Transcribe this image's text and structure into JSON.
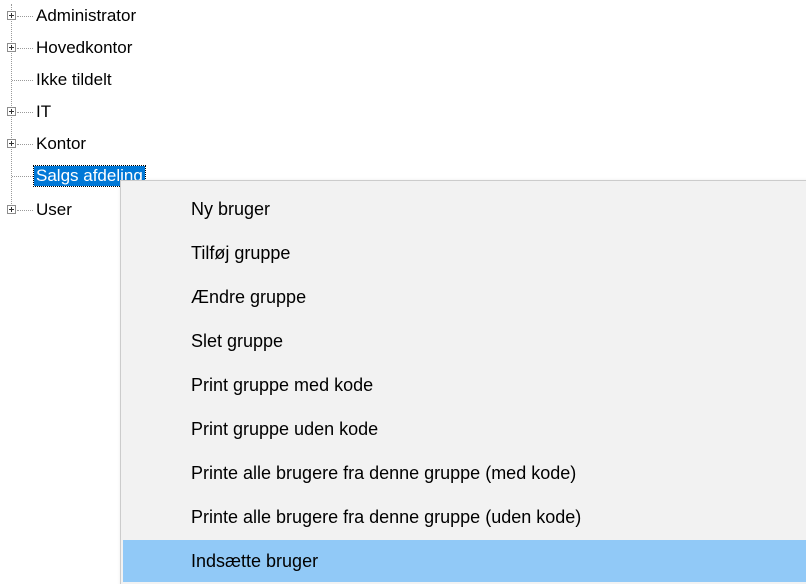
{
  "tree": {
    "items": [
      {
        "label": "Administrator",
        "expandable": true,
        "selected": false
      },
      {
        "label": "Hovedkontor",
        "expandable": true,
        "selected": false
      },
      {
        "label": "Ikke tildelt",
        "expandable": false,
        "selected": false
      },
      {
        "label": "IT",
        "expandable": true,
        "selected": false
      },
      {
        "label": "Kontor",
        "expandable": true,
        "selected": false
      },
      {
        "label": "Salgs afdeling",
        "expandable": false,
        "selected": true
      },
      {
        "label": "User",
        "expandable": true,
        "selected": false
      }
    ]
  },
  "context_menu": {
    "items": [
      {
        "label": "Ny bruger",
        "highlighted": false
      },
      {
        "label": "Tilføj gruppe",
        "highlighted": false
      },
      {
        "label": "Ændre gruppe",
        "highlighted": false
      },
      {
        "label": "Slet gruppe",
        "highlighted": false
      },
      {
        "label": "Print gruppe med kode",
        "highlighted": false
      },
      {
        "label": "Print gruppe uden kode",
        "highlighted": false
      },
      {
        "label": "Printe alle brugere fra denne gruppe (med kode)",
        "highlighted": false
      },
      {
        "label": "Printe alle brugere fra denne gruppe (uden kode)",
        "highlighted": false
      },
      {
        "label": "Indsætte bruger",
        "highlighted": true
      }
    ]
  },
  "colors": {
    "selection": "#0078d7",
    "menu_highlight": "#91c9f7",
    "menu_background": "#f2f2f2"
  }
}
